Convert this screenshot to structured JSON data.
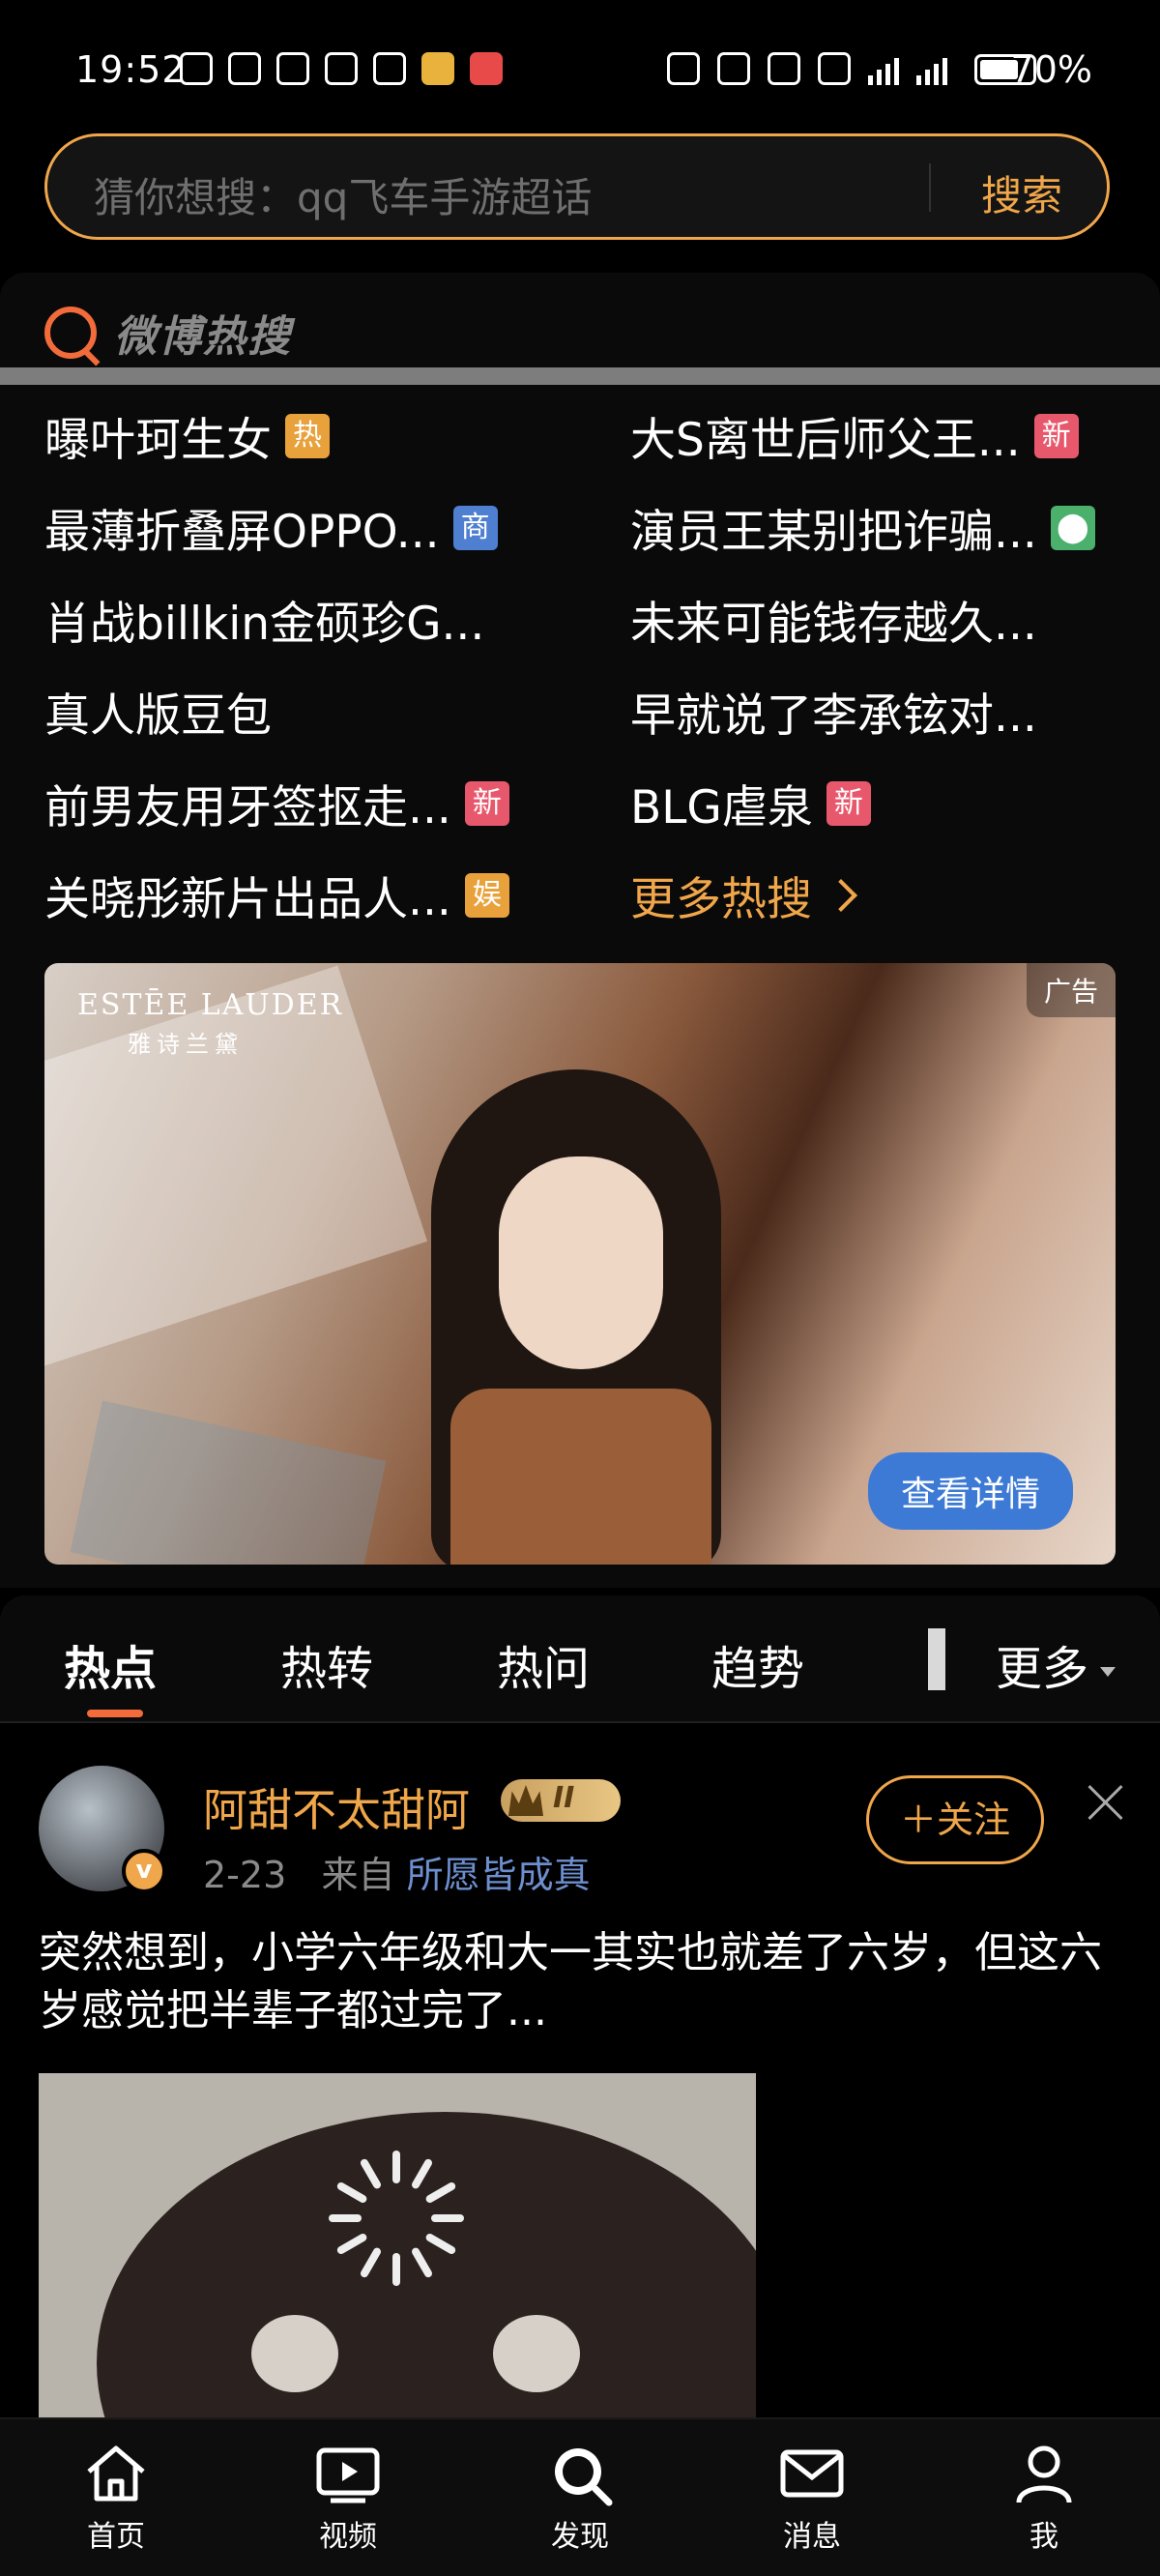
{
  "status": {
    "time": "19:52",
    "battery": "70%"
  },
  "search": {
    "placeholder": "猜你想搜：qq飞车手游超话",
    "button": "搜索"
  },
  "hot": {
    "logo_text": "微博热搜",
    "items": [
      {
        "text": "曝叶珂生女",
        "badge": "热",
        "badge_type": "hot"
      },
      {
        "text": "大S离世后师父王...",
        "badge": "新",
        "badge_type": "new"
      },
      {
        "text": "最薄折叠屏OPPO...",
        "badge": "商",
        "badge_type": "biz"
      },
      {
        "text": "演员王某别把诈骗...",
        "badge": "",
        "badge_type": "location"
      },
      {
        "text": "肖战billkin金硕珍G...",
        "badge": "",
        "badge_type": ""
      },
      {
        "text": "未来可能钱存越久...",
        "badge": "",
        "badge_type": ""
      },
      {
        "text": "真人版豆包",
        "badge": "",
        "badge_type": ""
      },
      {
        "text": "早就说了李承铉对...",
        "badge": "",
        "badge_type": ""
      },
      {
        "text": "前男友用牙签抠走...",
        "badge": "新",
        "badge_type": "new"
      },
      {
        "text": "BLG虐泉",
        "badge": "新",
        "badge_type": "new"
      },
      {
        "text": "关晓彤新片出品人...",
        "badge": "娱",
        "badge_type": "hot"
      }
    ],
    "more": "更多热搜"
  },
  "ad": {
    "brand": "ESTĒE LAUDER",
    "brand_cn": "雅诗兰黛",
    "label": "广告",
    "cta": "查看详情"
  },
  "tabs": {
    "items": [
      "热点",
      "热转",
      "热问",
      "趋势"
    ],
    "more": "更多"
  },
  "post": {
    "username": "阿甜不太甜阿",
    "level": "II",
    "date": "2-23",
    "from": "来自",
    "source": "所愿皆成真",
    "follow": "＋关注",
    "text": "突然想到，小学六年级和大一其实也就差了六岁，但这六岁感觉把半辈子都过完了..."
  },
  "nav": {
    "items": [
      "首页",
      "视频",
      "发现",
      "消息",
      "我"
    ]
  },
  "colors": {
    "accent": "#f0a64a",
    "hot_badge": "#e9a13b",
    "new_badge": "#e8586c",
    "biz_badge": "#4f7fd1",
    "loc_badge": "#4ab06b",
    "link": "#6d8fcf"
  }
}
